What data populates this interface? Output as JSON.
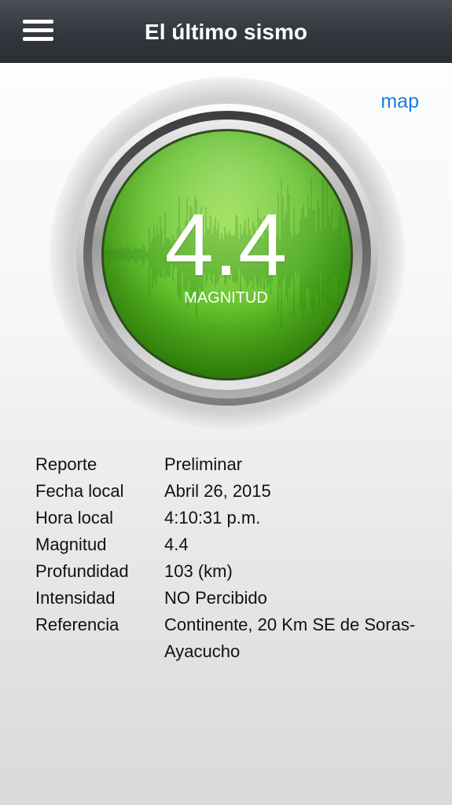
{
  "header": {
    "title": "El último sismo",
    "menu_icon": "hamburger-menu-icon"
  },
  "map_link": "map",
  "gauge": {
    "magnitude": "4.4",
    "label": "MAGNITUD",
    "colors": {
      "green_light": "#8fdc3c",
      "green_mid": "#52b41c",
      "green_dark": "#2c7a0a",
      "wave": "#2e8a12"
    }
  },
  "details": [
    {
      "label": "Reporte",
      "value": "Preliminar"
    },
    {
      "label": "Fecha local",
      "value": "Abril 26, 2015"
    },
    {
      "label": "Hora local",
      "value": "4:10:31 p.m."
    },
    {
      "label": "Magnitud",
      "value": "4.4"
    },
    {
      "label": "Profundidad",
      "value": "103 (km)"
    },
    {
      "label": "Intensidad",
      "value": "NO Percibido"
    },
    {
      "label": "Referencia",
      "value": "Continente, 20 Km SE de Soras-Ayacucho"
    }
  ]
}
